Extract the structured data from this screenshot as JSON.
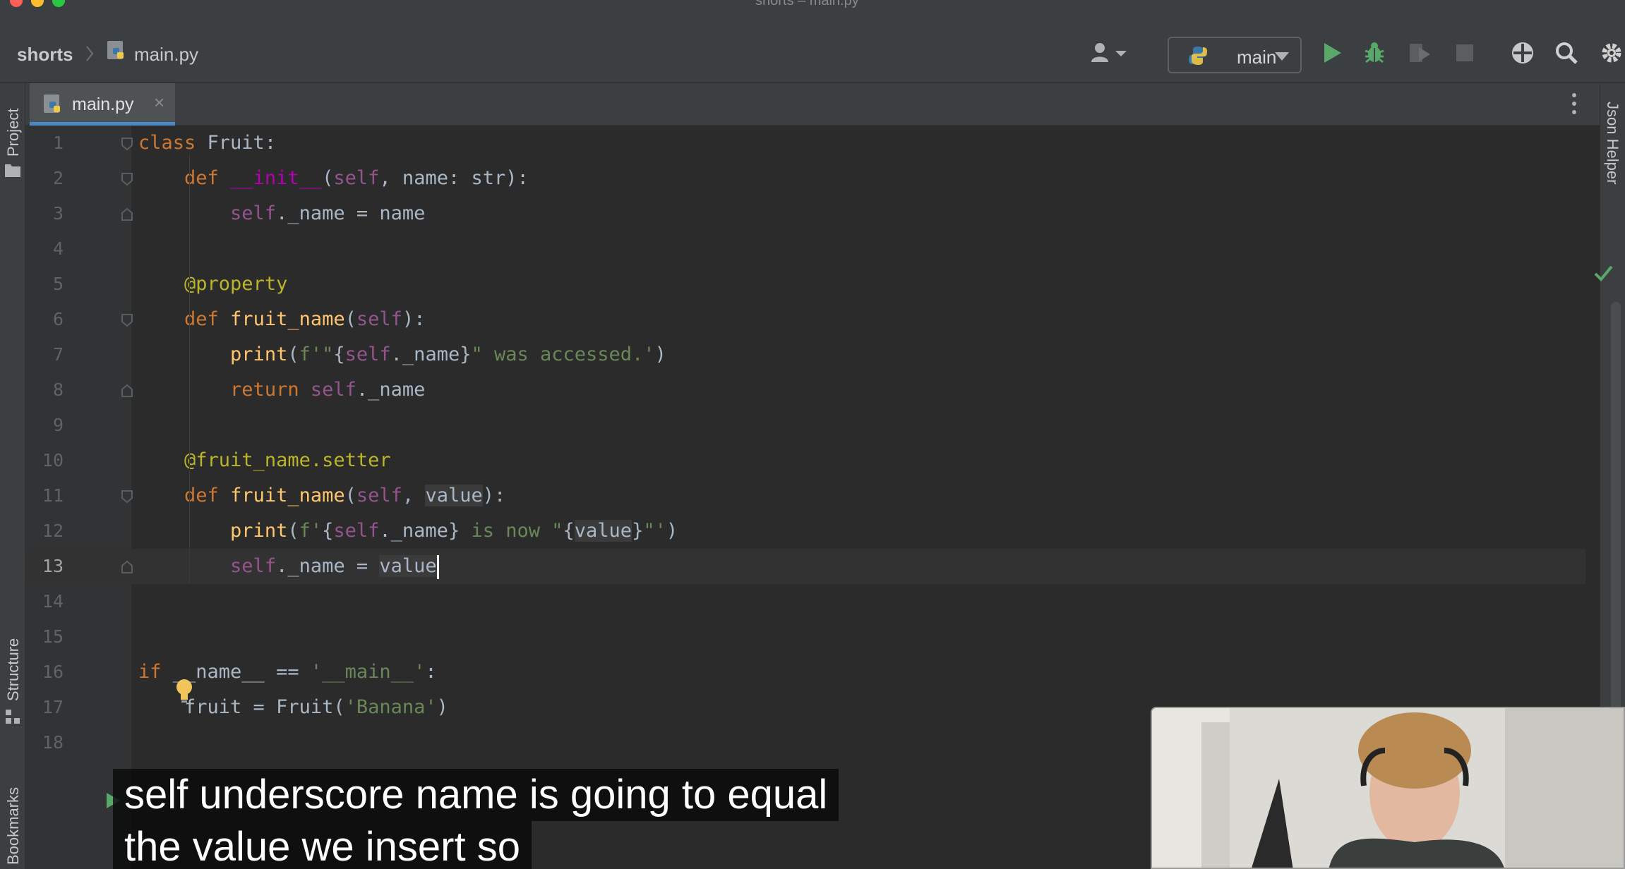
{
  "window": {
    "title": "shorts – main.py"
  },
  "breadcrumb": {
    "project": "shorts",
    "file": "main.py"
  },
  "run_config": {
    "label": "main"
  },
  "toolbar_icons": [
    "account-icon",
    "python-icon",
    "run-icon",
    "debug-icon",
    "coverage-icon",
    "stop-icon",
    "plugins-icon",
    "search-icon",
    "settings-icon"
  ],
  "tool_windows": {
    "left_top": "Project",
    "left_middle": "Structure",
    "left_bottom": "Bookmarks",
    "right_top": "Json Helper"
  },
  "tab": {
    "label": "main.py",
    "close": "×"
  },
  "editor": {
    "current_line": 13,
    "line_numbers": [
      "1",
      "2",
      "3",
      "4",
      "5",
      "6",
      "7",
      "8",
      "9",
      "10",
      "11",
      "12",
      "13",
      "14",
      "15",
      "16",
      "17",
      "18"
    ]
  },
  "subtitle": {
    "line1": "self underscore name is going to equal",
    "line2": "the value we insert so"
  },
  "colors": {
    "editor_bg": "#2b2b2b",
    "gutter_bg": "#313335",
    "keyword": "#cc7832",
    "self": "#94558d",
    "function": "#ffc66d",
    "string": "#6a8759",
    "decorator": "#bbb529",
    "run_green": "#59a869",
    "accent_blue": "#4a88c7"
  }
}
